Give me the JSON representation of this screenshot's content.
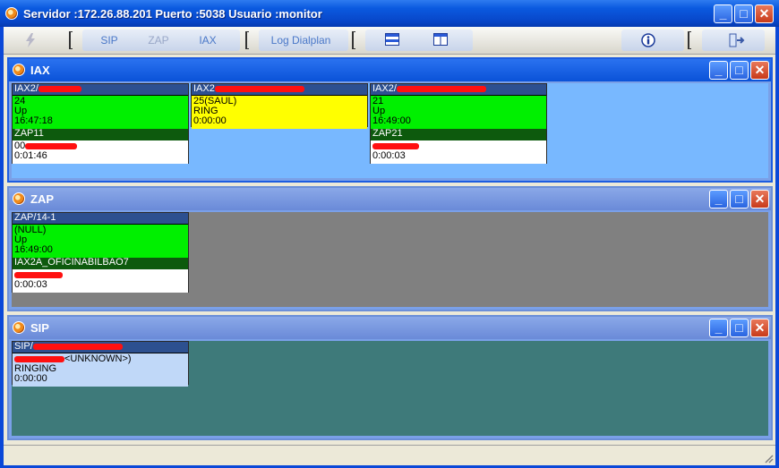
{
  "window": {
    "title": "Servidor :172.26.88.201 Puerto :5038 Usuario :monitor",
    "min": "_",
    "max": "□",
    "close": "✕"
  },
  "toolbar": {
    "sip": "SIP",
    "zap": "ZAP",
    "iax": "IAX",
    "log_dialplan": "Log Dialplan",
    "bolt_icon": "bolt-icon",
    "horizontal_layout_icon": "horizontal-layout-icon",
    "vertical_layout_icon": "vertical-layout-icon",
    "info_icon": "info-icon",
    "exit_icon": "exit-door-icon"
  },
  "colors": {
    "green": "#00f000",
    "yellow": "#ffff00",
    "light_blue": "#c0d8f8",
    "channel_header": "#2d5090",
    "link_header": "#0d5a0d",
    "iax_bg": "#78b8ff",
    "zap_bg": "#808080",
    "sip_bg": "#3e7a7a"
  },
  "panels": {
    "iax": {
      "title": "IAX",
      "cards": [
        {
          "header": "IAX2/",
          "line1": "24",
          "line2": "Up",
          "line3": "16:47:18",
          "link": "ZAP11",
          "peer": "00",
          "time": "0:01:46"
        },
        {
          "header": "IAX2",
          "line1": "25(SAUL)",
          "line2": "RING",
          "line3": "0:00:00"
        },
        {
          "header": "IAX2/",
          "line1": "21",
          "line2": "Up",
          "line3": "16:49:00",
          "link": "ZAP21",
          "peer": "",
          "time": "0:00:03"
        }
      ]
    },
    "zap": {
      "title": "ZAP",
      "cards": [
        {
          "header": "ZAP/14-1",
          "line1": "(NULL)",
          "line2": "Up",
          "line3": "16:49:00",
          "link": "IAX2A_OFICINABILBAO7",
          "peer": "",
          "time": "0:00:03"
        }
      ]
    },
    "sip": {
      "title": "SIP",
      "cards": [
        {
          "header": "SIP/",
          "line1": "<UNKNOWN>)",
          "line2": "RINGING",
          "line3": "0:00:00"
        }
      ]
    }
  }
}
